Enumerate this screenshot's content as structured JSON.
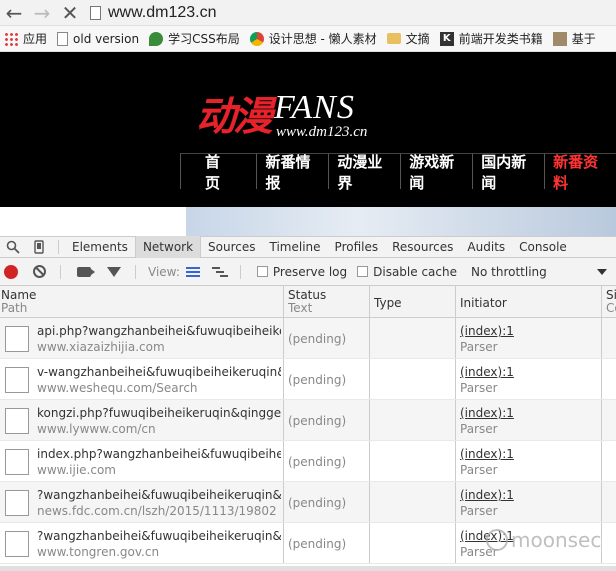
{
  "browser": {
    "back_icon": "back-arrow-icon",
    "forward_icon": "forward-arrow-icon",
    "close_icon": "stop-icon",
    "url": "www.dm123.cn"
  },
  "bookmarks": [
    {
      "label": "应用",
      "icon": "apps-icon"
    },
    {
      "label": "old version",
      "icon": "page-icon"
    },
    {
      "label": "学习CSS布局",
      "icon": "leaf-icon"
    },
    {
      "label": "设计思想 - 懒人素材",
      "icon": "chrome-icon"
    },
    {
      "label": "文摘",
      "icon": "folder-icon"
    },
    {
      "label": "前端开发类书籍",
      "icon": "k-icon"
    },
    {
      "label": "基于",
      "icon": "site-icon"
    }
  ],
  "site": {
    "logo_cn": "动漫",
    "logo_en": "FANS",
    "logo_url": "www.dm123.cn",
    "menu": [
      "首页",
      "新番情报",
      "动漫业界",
      "游戏新闻",
      "国内新闻",
      "新番资料"
    ]
  },
  "devtools": {
    "tabs": [
      "Elements",
      "Network",
      "Sources",
      "Timeline",
      "Profiles",
      "Resources",
      "Audits",
      "Console"
    ],
    "active_tab": "Network",
    "view_label": "View:",
    "preserve_log": "Preserve log",
    "disable_cache": "Disable cache",
    "throttling": "No throttling",
    "columns": {
      "name": "Name",
      "path": "Path",
      "status": "Status",
      "text": "Text",
      "type": "Type",
      "initiator": "Initiator",
      "size": "Siz",
      "content": "Co"
    },
    "rows": [
      {
        "name": "api.php?wangzhanbeihei&fuwuqibeiheikeru...",
        "path": "www.xiazaizhijia.com",
        "status": "(pending)",
        "initiator": "(index):1",
        "initiator_sub": "Parser"
      },
      {
        "name": "v-wangzhanbeihei&fuwuqibeiheikeruqin&qi...",
        "path": "www.weshequ.com/Search",
        "status": "(pending)",
        "initiator": "(index):1",
        "initiator_sub": "Parser"
      },
      {
        "name": "kongzi.php?fuwuqibeiheikeruqin&qinggeng...",
        "path": "www.lywww.com/cn",
        "status": "(pending)",
        "initiator": "(index):1",
        "initiator_sub": "Parser"
      },
      {
        "name": "index.php?wangzhanbeihei&fuwuqibeiheike...",
        "path": "www.ijie.com",
        "status": "(pending)",
        "initiator": "(index):1",
        "initiator_sub": "Parser"
      },
      {
        "name": "?wangzhanbeihei&fuwuqibeiheikeruqin&qi...",
        "path": "news.fdc.com.cn/lszh/2015/1113/19802",
        "status": "(pending)",
        "initiator": "(index):1",
        "initiator_sub": "Parser"
      },
      {
        "name": "?wangzhanbeihei&fuwuqibeiheikeruqin&qi...",
        "path": "www.tongren.gov.cn",
        "status": "(pending)",
        "initiator": "(index):1",
        "initiator_sub": "Parser"
      }
    ]
  },
  "watermark": "moonsec"
}
